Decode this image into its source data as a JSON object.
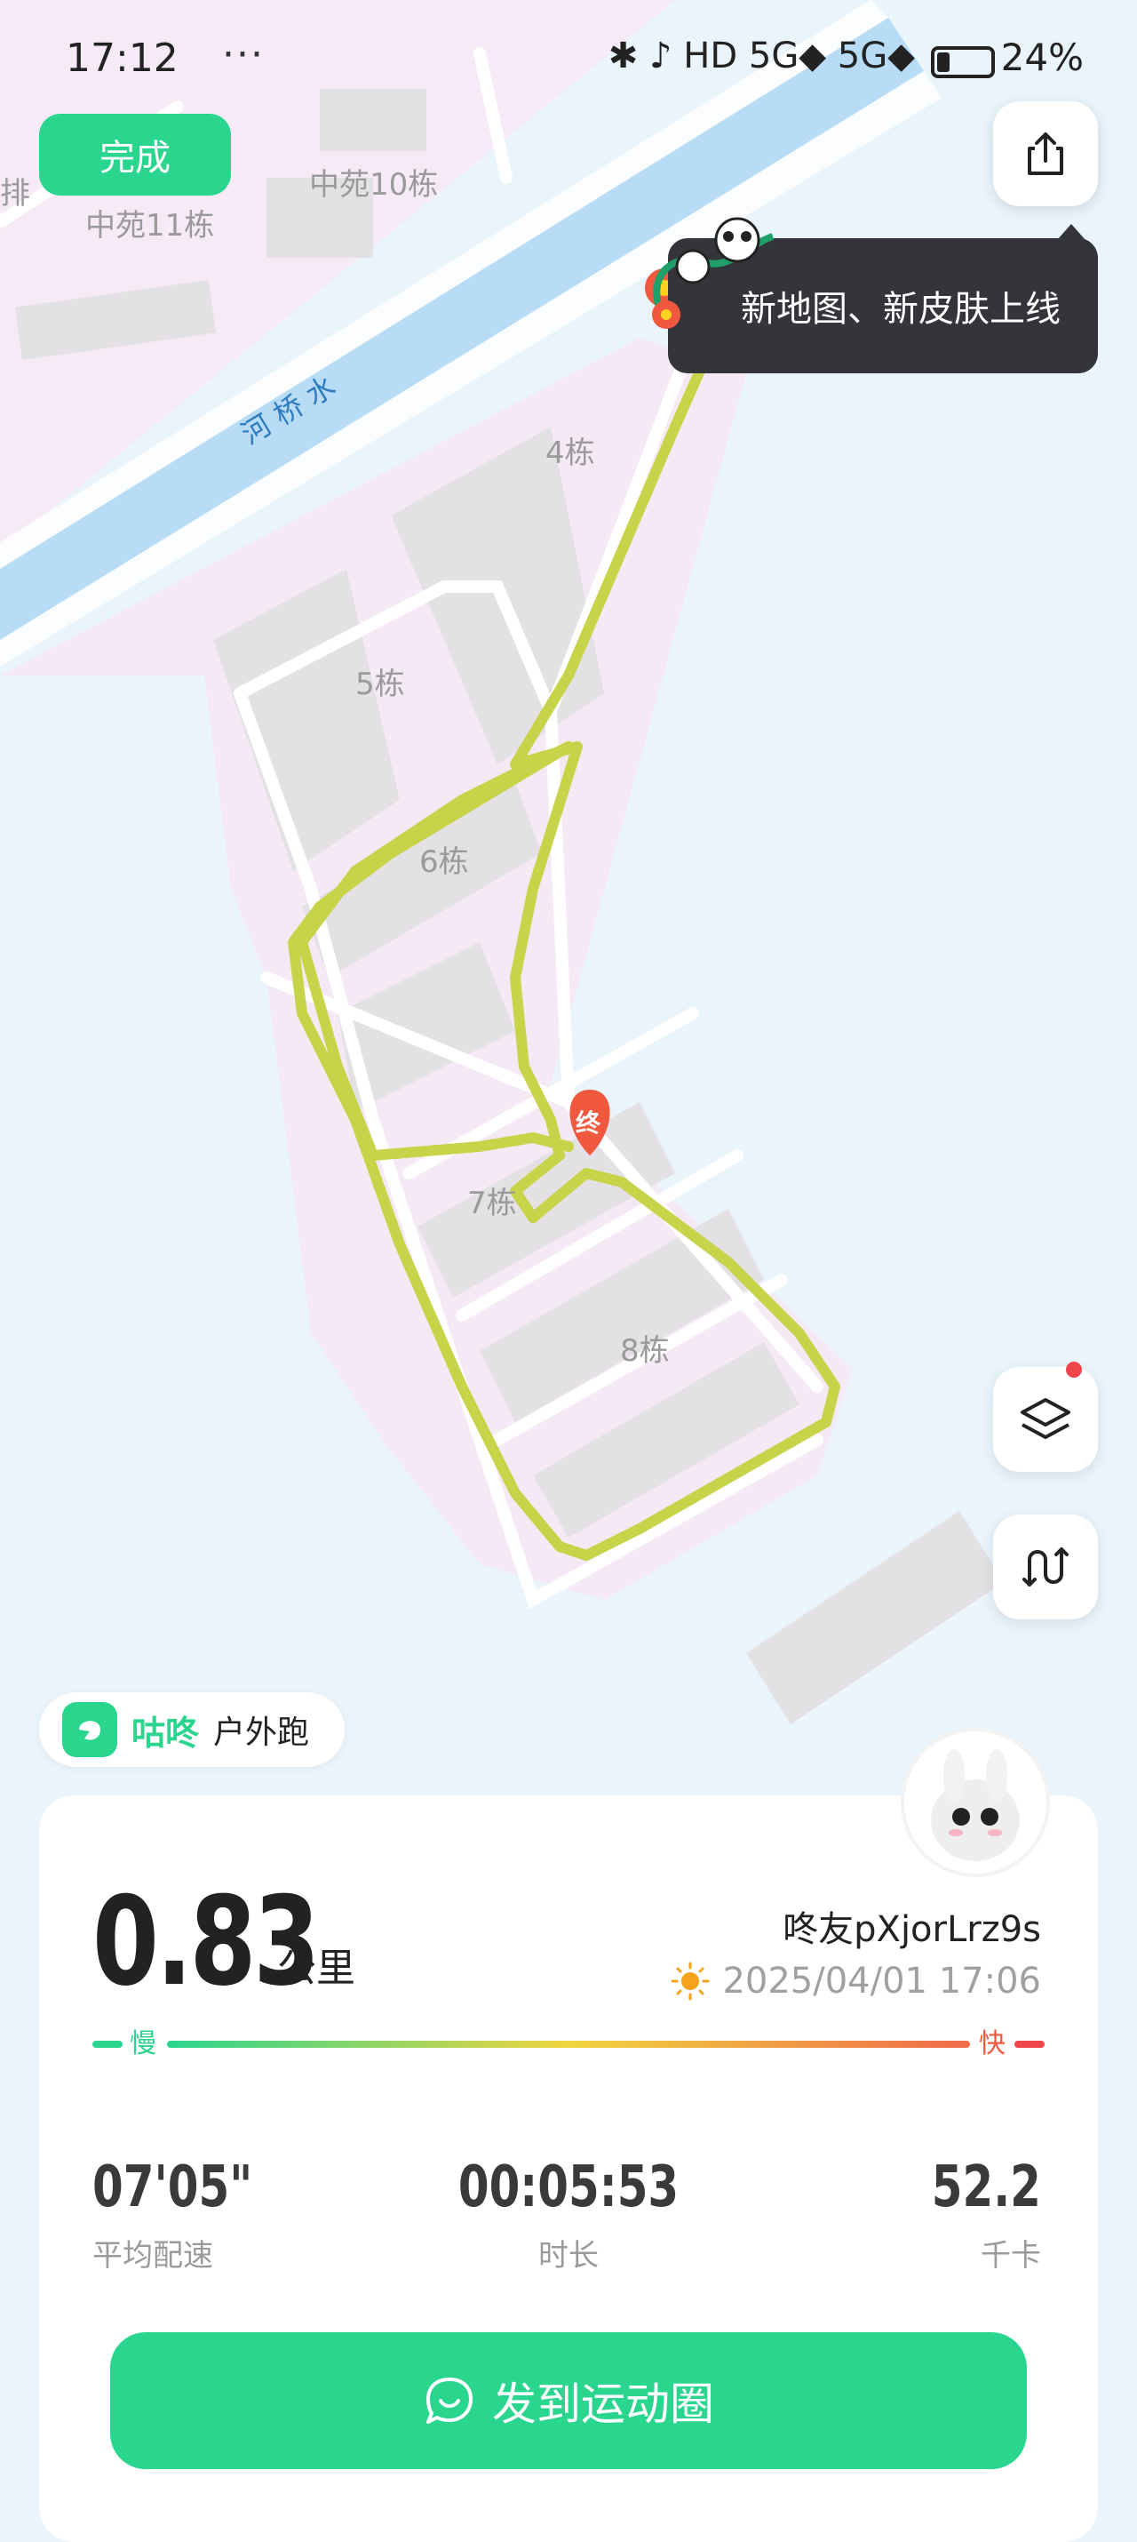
{
  "status_bar": {
    "time": "17:12",
    "extra": "···",
    "network_icons": "✱ ♪ HD 5G◆ 5G◆",
    "battery_percent": "24%"
  },
  "header": {
    "done_label": "完成",
    "tooltip_text": "新地图、新皮肤上线"
  },
  "map_labels": {
    "b11": "中苑11栋",
    "b10": "中苑10栋",
    "river": "河 桥 水",
    "b4": "4栋",
    "b5": "5栋",
    "b6": "6栋",
    "b7": "7栋",
    "b8": "8栋",
    "left_edge": "排",
    "end_marker": "终"
  },
  "brand": {
    "name": "咕咚",
    "activity": "户外跑"
  },
  "summary": {
    "distance": "0.83",
    "distance_unit": "公里",
    "username": "咚友pXjorLrz9s",
    "datetime": "2025/04/01 17:06",
    "pace_slow": "慢",
    "pace_fast": "快"
  },
  "stats": [
    {
      "value": "07'05\"",
      "label": "平均配速"
    },
    {
      "value": "00:05:53",
      "label": "时长"
    },
    {
      "value": "52.2",
      "label": "千卡"
    }
  ],
  "post_button_label": "发到运动圈",
  "colors": {
    "accent": "#2ad58e",
    "route": "#c7d44a",
    "end_marker": "#f0593e"
  }
}
